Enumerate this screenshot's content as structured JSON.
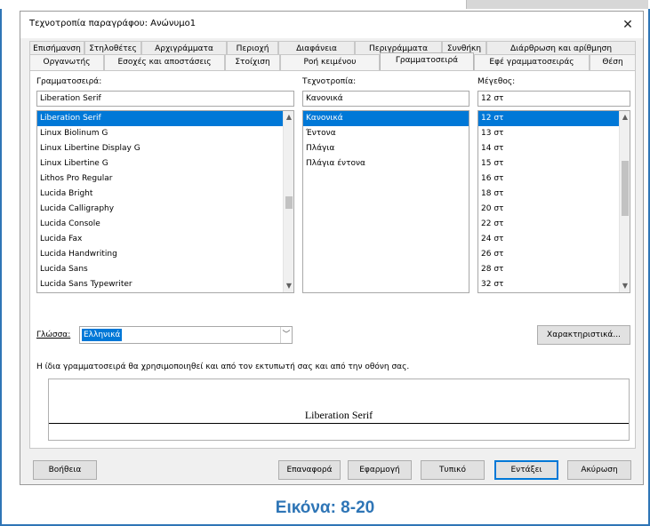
{
  "window": {
    "title": "Τεχνοτροπία παραγράφου: Ανώνυμο1"
  },
  "tabs_row1": [
    "Επισήμανση",
    "Στηλοθέτες",
    "Αρχιγράμματα",
    "Περιοχή",
    "Διαφάνεια",
    "Περιγράμματα",
    "Συνθήκη",
    "Διάρθρωση και αρίθμηση"
  ],
  "tabs_row2": [
    "Οργανωτής",
    "Εσοχές και αποστάσεις",
    "Στοίχιση",
    "Ροή κειμένου",
    "Γραμματοσειρά",
    "Εφέ γραμματοσειράς",
    "Θέση"
  ],
  "font": {
    "family_label": "Γραμματοσειρά:",
    "family_value": "Liberation Serif",
    "family_list": [
      "Liberation Serif",
      "Linux Biolinum G",
      "Linux Libertine Display G",
      "Linux Libertine G",
      "Lithos Pro Regular",
      "Lucida Bright",
      "Lucida Calligraphy",
      "Lucida Console",
      "Lucida Fax",
      "Lucida Handwriting",
      "Lucida Sans",
      "Lucida Sans Typewriter"
    ],
    "style_label": "Τεχνοτροπία:",
    "style_value": "Κανονικά",
    "style_list": [
      "Κανονικά",
      "Έντονα",
      "Πλάγια",
      "Πλάγια έντονα"
    ],
    "size_label": "Μέγεθος:",
    "size_value": "12 στ",
    "size_list": [
      "12 στ",
      "13 στ",
      "14 στ",
      "15 στ",
      "16 στ",
      "18 στ",
      "20 στ",
      "22 στ",
      "24 στ",
      "26 στ",
      "28 στ",
      "32 στ"
    ]
  },
  "language": {
    "label": "Γλώσσα:",
    "value": "Ελληνικά"
  },
  "features_button": "Χαρακτηριστικά...",
  "info_text": "Η ίδια γραμματοσειρά θα χρησιμοποιηθεί και από τον εκτυπωτή σας και από την οθόνη σας.",
  "preview_text": "Liberation Serif",
  "buttons": {
    "help": "Βοήθεια",
    "reset": "Επαναφορά",
    "apply": "Εφαρμογή",
    "standard": "Τυπικό",
    "ok": "Εντάξει",
    "cancel": "Ακύρωση"
  },
  "caption": "Εικόνα: 8-20",
  "colors": {
    "accent": "#2e75b6",
    "selection": "#0078d7"
  }
}
